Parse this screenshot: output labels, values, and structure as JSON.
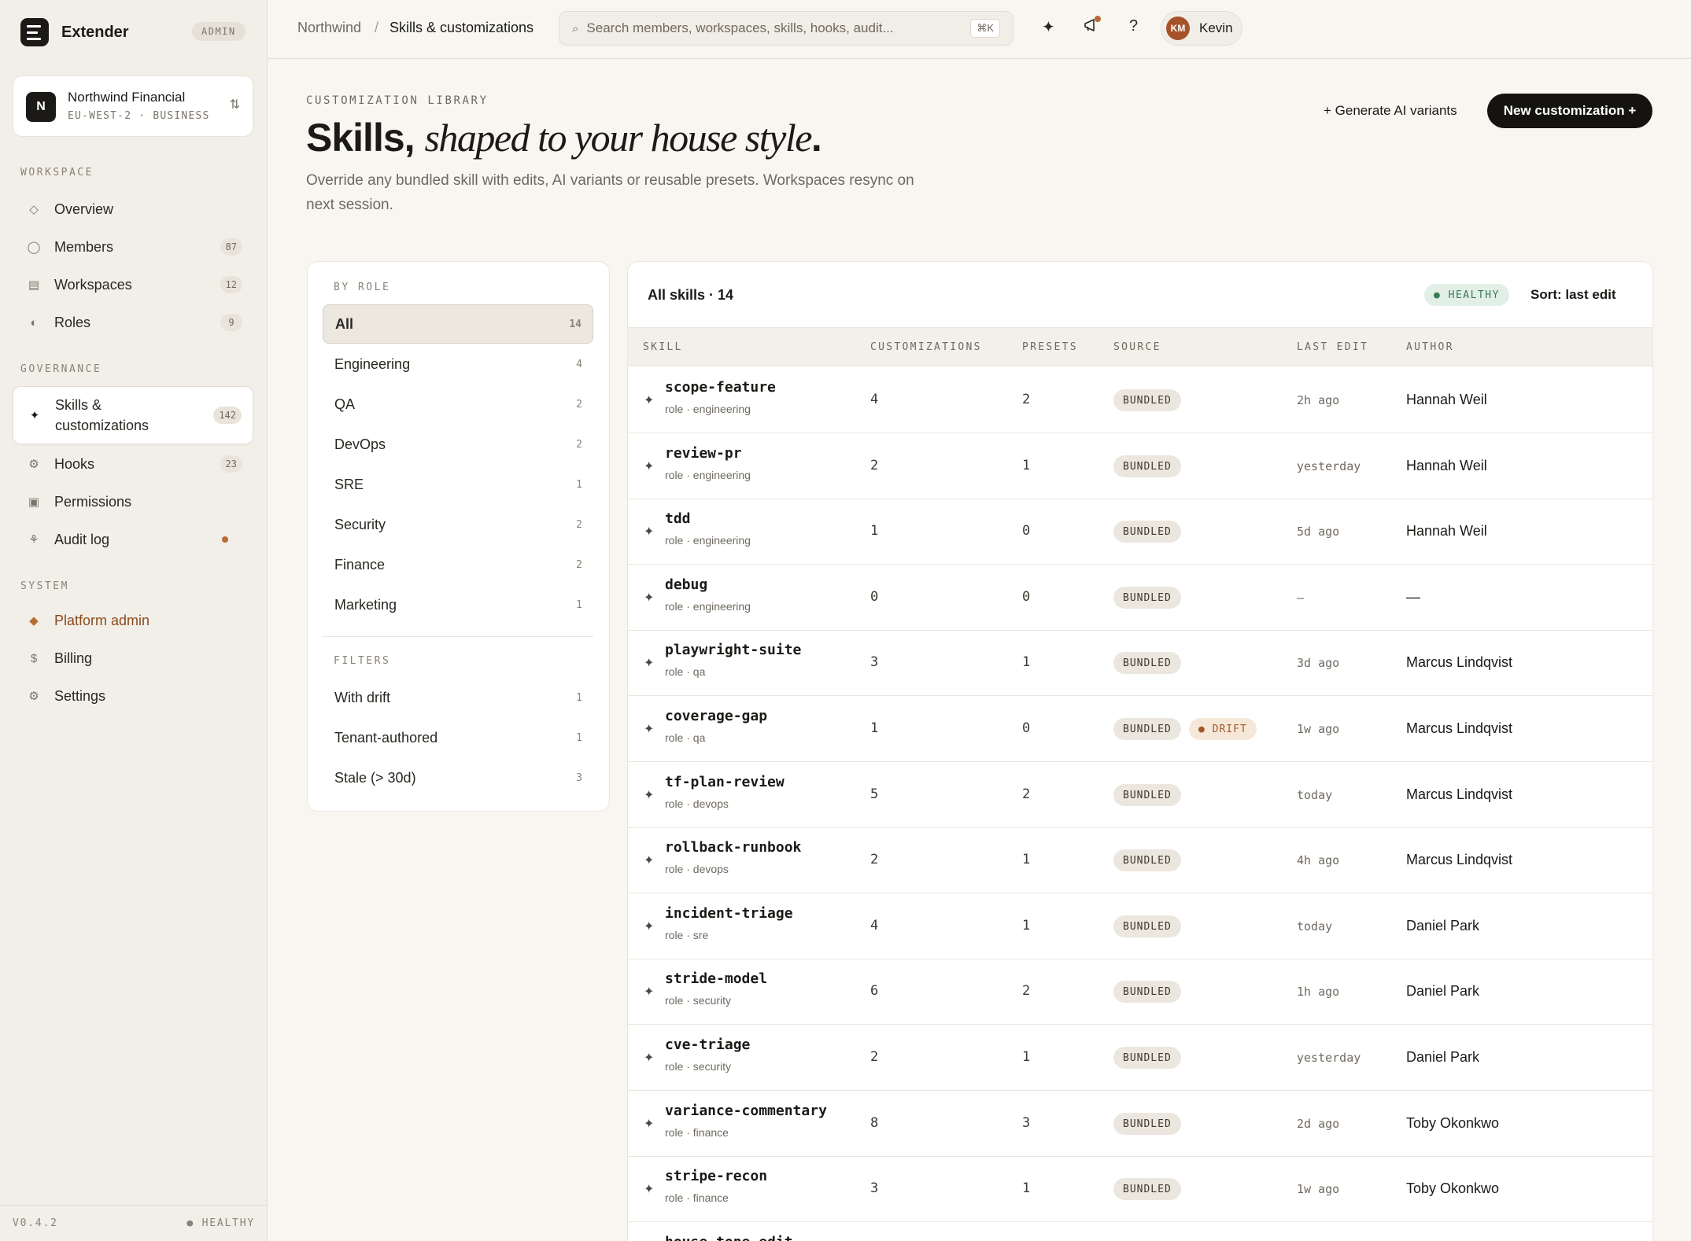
{
  "app": {
    "name": "Extender",
    "role_badge": "ADMIN"
  },
  "tenant": {
    "initial": "N",
    "name": "Northwind Financial",
    "meta": "EU-WEST-2 · BUSINESS",
    "switch_icon": "⇅"
  },
  "sidebar": {
    "workspace_label": "WORKSPACE",
    "workspace_items": [
      {
        "label": "Overview",
        "icon": "◇",
        "count": ""
      },
      {
        "label": "Members",
        "icon": "◯",
        "count": "87"
      },
      {
        "label": "Workspaces",
        "icon": "▤",
        "count": "12"
      },
      {
        "label": "Roles",
        "icon": "◐",
        "count": "9"
      }
    ],
    "governance_label": "GOVERNANCE",
    "governance_items": [
      {
        "label": "Skills & customizations",
        "icon": "✦",
        "count": "142"
      },
      {
        "label": "Hooks",
        "icon": "⚙",
        "count": "23"
      },
      {
        "label": "Permissions",
        "icon": "▣",
        "count": ""
      },
      {
        "label": "Audit log",
        "icon": "⚘",
        "count": ""
      }
    ],
    "system_label": "SYSTEM",
    "system_items": [
      {
        "label": "Platform admin",
        "icon": "◆"
      },
      {
        "label": "Billing",
        "icon": "$"
      },
      {
        "label": "Settings",
        "icon": "⚙"
      }
    ],
    "version": "V0.4.2",
    "health": "● HEALTHY"
  },
  "topbar": {
    "crumb_root": "Northwind",
    "crumb_sep": "/",
    "crumb_current": "Skills & customizations",
    "search_placeholder": "Search members, workspaces, skills, hooks, audit...",
    "search_shortcut": "⌘K",
    "user_initials": "KM",
    "user_name": "Kevin"
  },
  "header": {
    "eyebrow": "CUSTOMIZATION LIBRARY",
    "title_lead": "Skills,",
    "title_accent": "shaped to your house style",
    "title_end": ".",
    "subtitle": "Override any bundled skill with edits, AI variants or reusable presets. Workspaces resync on next session.",
    "generate_label": "+ Generate AI variants",
    "new_label": "New customization +"
  },
  "filters": {
    "role_label": "BY ROLE",
    "roles": [
      {
        "name": "All",
        "count": "14"
      },
      {
        "name": "Engineering",
        "count": "4"
      },
      {
        "name": "QA",
        "count": "2"
      },
      {
        "name": "DevOps",
        "count": "2"
      },
      {
        "name": "SRE",
        "count": "1"
      },
      {
        "name": "Security",
        "count": "2"
      },
      {
        "name": "Finance",
        "count": "2"
      },
      {
        "name": "Marketing",
        "count": "1"
      }
    ],
    "filters_label": "FILTERS",
    "filters": [
      {
        "name": "With drift",
        "count": "1"
      },
      {
        "name": "Tenant-authored",
        "count": "1"
      },
      {
        "name": "Stale (> 30d)",
        "count": "3"
      }
    ]
  },
  "table": {
    "title": "All skills · 14",
    "health": "● HEALTHY",
    "sort": "Sort: last edit",
    "columns": [
      "SKILL",
      "CUSTOMIZATIONS",
      "PRESETS",
      "SOURCE",
      "LAST EDIT",
      "AUTHOR"
    ],
    "rows": [
      {
        "name": "scope-feature",
        "role": "role · engineering",
        "custom": "4",
        "presets": "2",
        "source": "BUNDLED",
        "drift": "",
        "edit": "2h ago",
        "author": "Hannah Weil"
      },
      {
        "name": "review-pr",
        "role": "role · engineering",
        "custom": "2",
        "presets": "1",
        "source": "BUNDLED",
        "drift": "",
        "edit": "yesterday",
        "author": "Hannah Weil"
      },
      {
        "name": "tdd",
        "role": "role · engineering",
        "custom": "1",
        "presets": "0",
        "source": "BUNDLED",
        "drift": "",
        "edit": "5d ago",
        "author": "Hannah Weil"
      },
      {
        "name": "debug",
        "role": "role · engineering",
        "custom": "0",
        "presets": "0",
        "source": "BUNDLED",
        "drift": "",
        "edit": "—",
        "author": "—"
      },
      {
        "name": "playwright-suite",
        "role": "role · qa",
        "custom": "3",
        "presets": "1",
        "source": "BUNDLED",
        "drift": "",
        "edit": "3d ago",
        "author": "Marcus Lindqvist"
      },
      {
        "name": "coverage-gap",
        "role": "role · qa",
        "custom": "1",
        "presets": "0",
        "source": "BUNDLED",
        "drift": "● DRIFT",
        "edit": "1w ago",
        "author": "Marcus Lindqvist"
      },
      {
        "name": "tf-plan-review",
        "role": "role · devops",
        "custom": "5",
        "presets": "2",
        "source": "BUNDLED",
        "drift": "",
        "edit": "today",
        "author": "Marcus Lindqvist"
      },
      {
        "name": "rollback-runbook",
        "role": "role · devops",
        "custom": "2",
        "presets": "1",
        "source": "BUNDLED",
        "drift": "",
        "edit": "4h ago",
        "author": "Marcus Lindqvist"
      },
      {
        "name": "incident-triage",
        "role": "role · sre",
        "custom": "4",
        "presets": "1",
        "source": "BUNDLED",
        "drift": "",
        "edit": "today",
        "author": "Daniel Park"
      },
      {
        "name": "stride-model",
        "role": "role · security",
        "custom": "6",
        "presets": "2",
        "source": "BUNDLED",
        "drift": "",
        "edit": "1h ago",
        "author": "Daniel Park"
      },
      {
        "name": "cve-triage",
        "role": "role · security",
        "custom": "2",
        "presets": "1",
        "source": "BUNDLED",
        "drift": "",
        "edit": "yesterday",
        "author": "Daniel Park"
      },
      {
        "name": "variance-commentary",
        "role": "role · finance",
        "custom": "8",
        "presets": "3",
        "source": "BUNDLED",
        "drift": "",
        "edit": "2d ago",
        "author": "Toby Okonkwo"
      },
      {
        "name": "stripe-recon",
        "role": "role · finance",
        "custom": "3",
        "presets": "1",
        "source": "BUNDLED",
        "drift": "",
        "edit": "1w ago",
        "author": "Toby Okonkwo"
      },
      {
        "name": "house-tone-edit",
        "role": "",
        "custom": "",
        "presets": "",
        "source": "",
        "drift": "",
        "edit": "",
        "author": ""
      }
    ]
  }
}
